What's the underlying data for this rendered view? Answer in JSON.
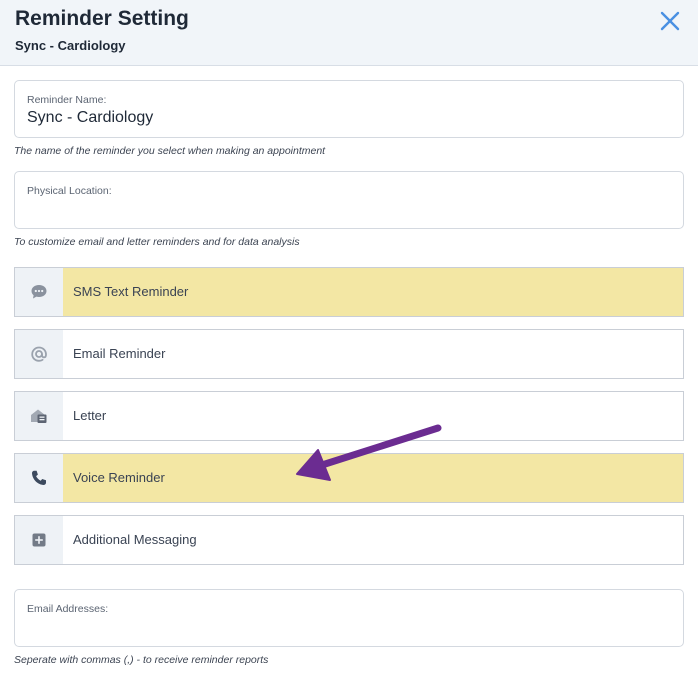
{
  "header": {
    "title": "Reminder Setting",
    "subtitle": "Sync - Cardiology",
    "close_icon": "close-icon"
  },
  "reminder_name": {
    "label": "Reminder Name:",
    "value": "Sync - Cardiology",
    "hint": "The name of the reminder you select when making an appointment"
  },
  "physical_location": {
    "label": "Physical Location:",
    "value": "",
    "hint": "To customize email and letter reminders and for data analysis"
  },
  "options": [
    {
      "label": "SMS Text Reminder",
      "icon": "chat-bubble-icon",
      "active": true
    },
    {
      "label": "Email Reminder",
      "icon": "at-sign-icon",
      "active": false
    },
    {
      "label": "Letter",
      "icon": "mailbox-icon",
      "active": false
    },
    {
      "label": "Voice Reminder",
      "icon": "phone-icon",
      "active": true
    },
    {
      "label": "Additional Messaging",
      "icon": "plus-square-icon",
      "active": false
    }
  ],
  "email_addresses": {
    "label": "Email Addresses:",
    "value": "",
    "hint": "Seperate with commas (,) - to receive reminder reports"
  },
  "colors": {
    "active_row": "#f3e7a4",
    "close_icon": "#4a90e2",
    "annotation_arrow": "#6b2c91"
  }
}
